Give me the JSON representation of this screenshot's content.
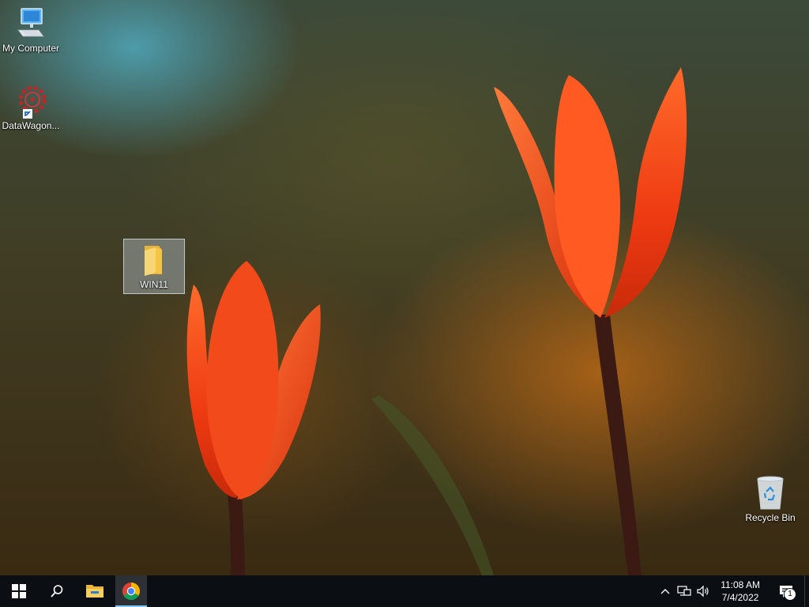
{
  "desktop": {
    "icons": [
      {
        "label": "My Computer",
        "icon": "computer-icon"
      },
      {
        "label": "DataWagon...",
        "icon": "gear-shortcut-icon"
      },
      {
        "label": "WIN11",
        "icon": "folder-icon"
      },
      {
        "label": "Recycle Bin",
        "icon": "recycle-bin-icon"
      }
    ]
  },
  "taskbar": {
    "buttons": [
      {
        "icon": "windows-start-icon"
      },
      {
        "icon": "search-icon"
      },
      {
        "icon": "file-explorer-icon"
      },
      {
        "icon": "chrome-icon",
        "active": true
      }
    ],
    "tray": {
      "icons": [
        "chevron-up-icon",
        "network-icon",
        "volume-icon"
      ],
      "time": "11:08 AM",
      "date": "7/4/2022",
      "notification_count": "1"
    }
  },
  "colors": {
    "taskbar": "#0b0f14",
    "active_indicator": "#7ec7ff",
    "folder": "#f5c542"
  }
}
